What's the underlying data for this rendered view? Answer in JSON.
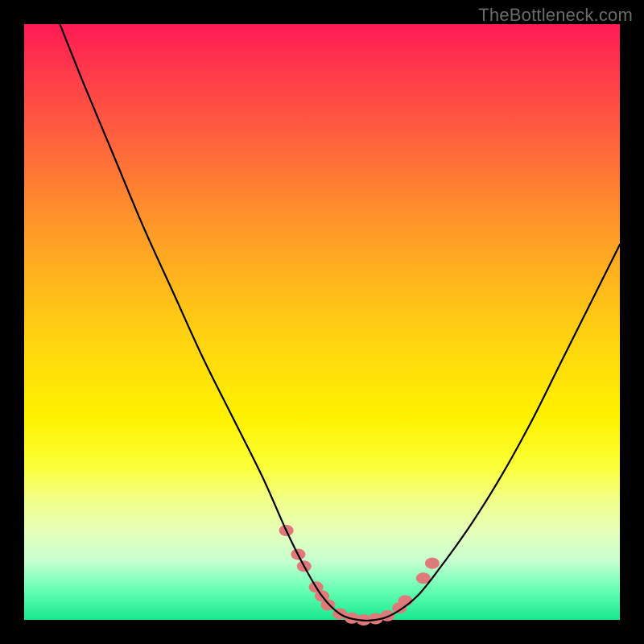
{
  "watermark": "TheBottleneck.com",
  "chart_data": {
    "type": "line",
    "title": "",
    "xlabel": "",
    "ylabel": "",
    "xlim": [
      0,
      100
    ],
    "ylim": [
      0,
      100
    ],
    "grid": false,
    "legend": false,
    "series": [
      {
        "name": "curve",
        "color": "#000000",
        "x": [
          6,
          10,
          15,
          20,
          25,
          30,
          35,
          40,
          44,
          47,
          50,
          53,
          56,
          59,
          62,
          66,
          70,
          75,
          80,
          85,
          90,
          95,
          100
        ],
        "y": [
          100,
          90,
          78,
          66,
          55,
          44,
          34,
          24,
          15,
          9,
          4,
          1,
          0,
          0,
          1,
          4,
          9,
          16,
          24,
          33,
          43,
          53,
          63
        ]
      }
    ],
    "annotations": [
      {
        "name": "trough-highlight",
        "type": "dots",
        "color": "#e07a7a",
        "points": [
          {
            "x": 44,
            "y": 15
          },
          {
            "x": 46,
            "y": 11
          },
          {
            "x": 47,
            "y": 9
          },
          {
            "x": 49,
            "y": 5.5
          },
          {
            "x": 50,
            "y": 4
          },
          {
            "x": 51,
            "y": 2.5
          },
          {
            "x": 53,
            "y": 1
          },
          {
            "x": 55,
            "y": 0.3
          },
          {
            "x": 57,
            "y": 0
          },
          {
            "x": 59,
            "y": 0.2
          },
          {
            "x": 61,
            "y": 0.7
          },
          {
            "x": 63,
            "y": 2
          },
          {
            "x": 64,
            "y": 3.2
          },
          {
            "x": 67,
            "y": 7
          },
          {
            "x": 68.5,
            "y": 9.5
          }
        ]
      }
    ]
  }
}
